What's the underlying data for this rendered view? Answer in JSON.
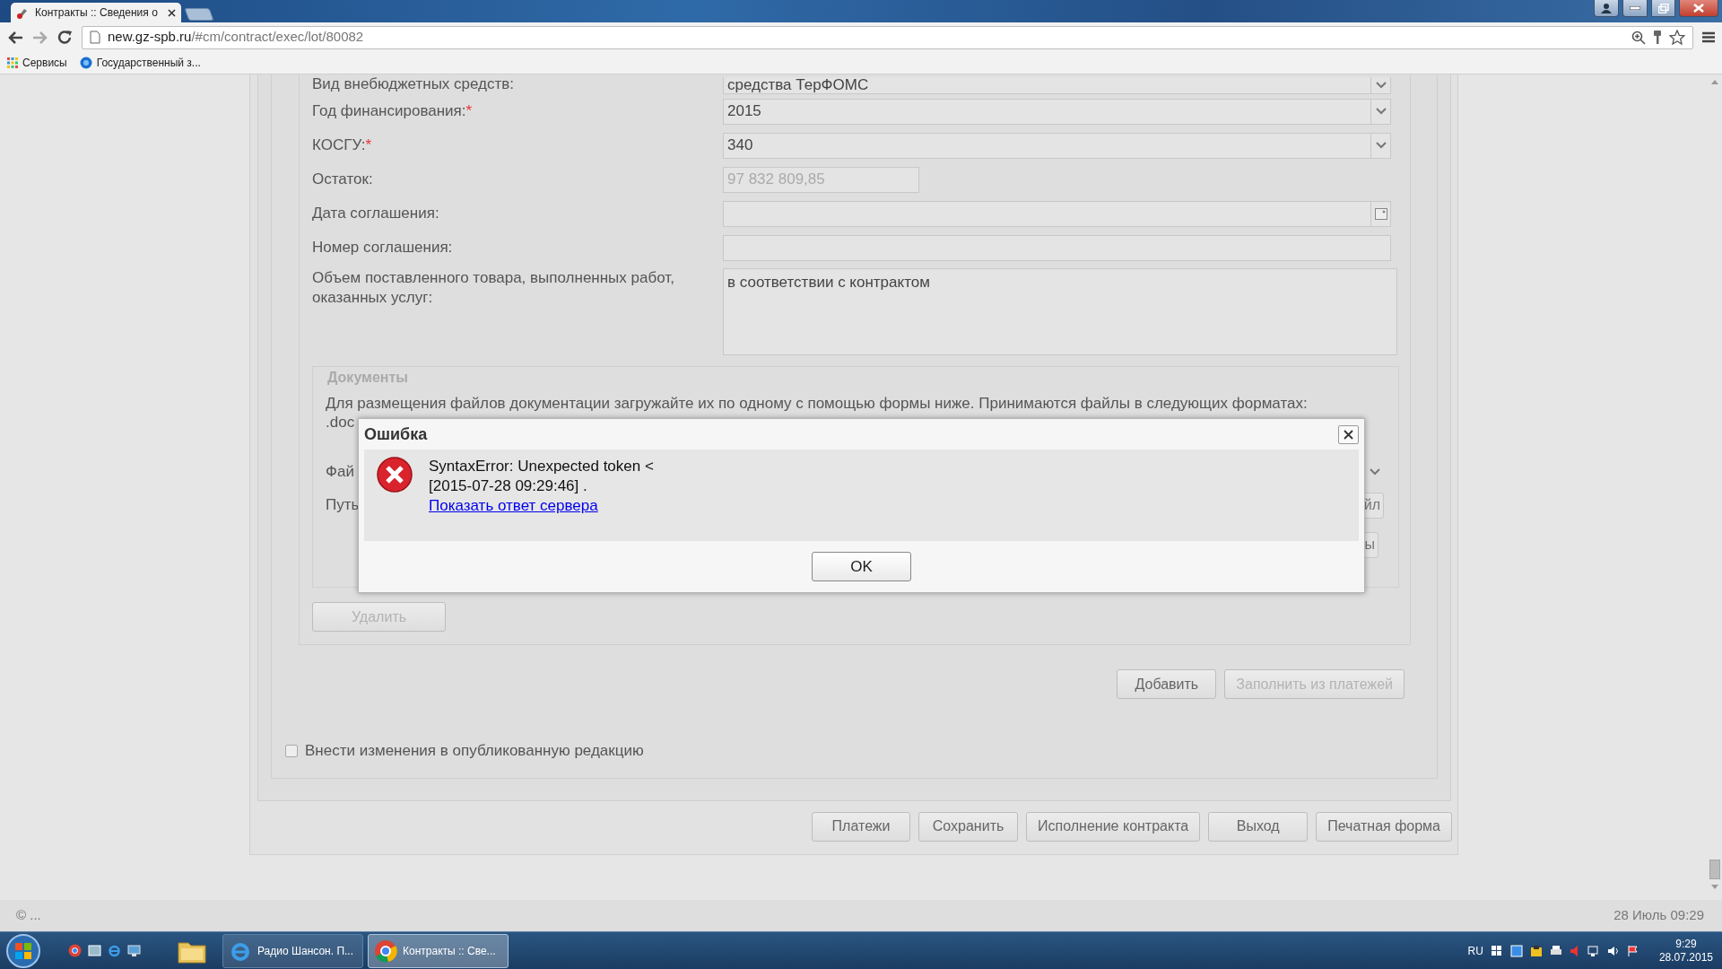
{
  "browser": {
    "tab_title": "Контракты :: Сведения о",
    "url_host": "new.gz-spb.ru",
    "url_path": "/#cm/contract/exec/lot/80082",
    "bookmarks": [
      {
        "label": "Сервисы",
        "kind": "apps"
      },
      {
        "label": "Государственный з...",
        "kind": "site"
      }
    ]
  },
  "form": {
    "fields": [
      {
        "label": "Вид внебюджетных средств:",
        "value": "средства ТерФОМС",
        "kind": "select"
      },
      {
        "label": "Год финансирования:",
        "required_mark": "*",
        "value": "2015",
        "kind": "select"
      },
      {
        "label": "КОСГУ:",
        "required_mark": "*",
        "value": "340",
        "kind": "select"
      },
      {
        "label": "Остаток:",
        "value": "97 832 809,85",
        "kind": "readonly"
      },
      {
        "label": "Дата соглашения:",
        "kind": "date"
      },
      {
        "label": "Номер соглашения:",
        "kind": "text"
      },
      {
        "label": "Объем поставленного товара, выполненных работ, оказанных услуг:",
        "value": "в соответствии с контрактом",
        "kind": "textarea"
      }
    ]
  },
  "documents": {
    "legend": "Документы",
    "note": "Для размещения файлов документации загружайте их по одному с помощью формы ниже. Принимаются файлы в следующих форматах:",
    "note_tail": ".doc",
    "file_label": "Фай",
    "path_label": "Путь",
    "file_button": "йл",
    "files_button": "ы"
  },
  "delete_button": {
    "label": "Удалить",
    "disabled": true
  },
  "actions": [
    {
      "label": "Добавить",
      "disabled": false
    },
    {
      "label": "Заполнить из платежей",
      "disabled": true
    }
  ],
  "publish_checkbox": {
    "label": "Внести изменения в опубликованную редакцию",
    "checked": false
  },
  "footer_buttons": [
    {
      "label": "Платежи",
      "disabled": false
    },
    {
      "label": "Сохранить",
      "disabled": false
    },
    {
      "label": "Исполнение контракта",
      "disabled": false
    },
    {
      "label": "Выход",
      "disabled": false
    },
    {
      "label": "Печатная форма",
      "disabled": false
    }
  ],
  "status_bar": {
    "left": "© ...",
    "right": "28 Июль 09:29"
  },
  "dialog": {
    "title": "Ошибка",
    "kind": "error",
    "lines": [
      "SyntaxError: Unexpected token <",
      "[2015-07-28 09:29:46] ."
    ],
    "link": "Показать ответ сервера",
    "button": "OK"
  },
  "taskbar": {
    "tasks": [
      {
        "label": "Радио Шансон. П...",
        "kind": "ie",
        "selected": false
      },
      {
        "label": "Контракты :: Све...",
        "kind": "chrome",
        "selected": true
      }
    ],
    "language": "RU",
    "time": "9:29",
    "date": "28.07.2015"
  }
}
